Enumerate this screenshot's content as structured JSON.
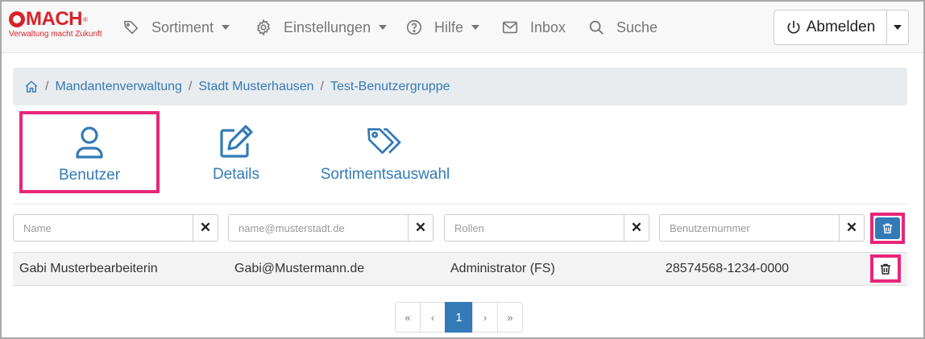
{
  "brand": {
    "name": "MACH",
    "registered": "®",
    "tagline": "Verwaltung macht Zukunft"
  },
  "nav": {
    "sortiment": "Sortiment",
    "einstellungen": "Einstellungen",
    "hilfe": "Hilfe",
    "inbox": "Inbox",
    "suche": "Suche",
    "logout": "Abmelden"
  },
  "breadcrumb": {
    "items": [
      "Mandantenverwaltung",
      "Stadt Musterhausen",
      "Test-Benutzergruppe"
    ],
    "separator": "/"
  },
  "tabs": {
    "benutzer": "Benutzer",
    "details": "Details",
    "sortimentsauswahl": "Sortimentsauswahl",
    "active": "Benutzer"
  },
  "filters": {
    "name": {
      "placeholder": "Name",
      "value": ""
    },
    "email": {
      "placeholder": "name@musterstadt.de",
      "value": ""
    },
    "rollen": {
      "placeholder": "Rollen",
      "value": ""
    },
    "benutzernummer": {
      "placeholder": "Benutzernummer",
      "value": ""
    },
    "clear_label": "✕"
  },
  "rows": [
    {
      "name": "Gabi Musterbearbeiterin",
      "email": "Gabi@Mustermann.de",
      "rolle": "Administrator (FS)",
      "benutzernummer": "28574568-1234-0000"
    }
  ],
  "pagination": {
    "first": "«",
    "prev": "‹",
    "current": "1",
    "next": "›",
    "last": "»"
  },
  "colors": {
    "primary": "#337ab7",
    "highlight": "#e8267a",
    "brand": "#d8232a"
  },
  "icons": {
    "sortiment": "tags-icon",
    "einstellungen": "gear-icon",
    "hilfe": "question-circle-icon",
    "inbox": "envelope-icon",
    "suche": "search-icon",
    "logout": "power-icon",
    "home": "home-icon",
    "benutzer": "user-icon",
    "details": "edit-icon",
    "sortimentsauswahl": "tags-icon",
    "delete": "trash-icon"
  }
}
